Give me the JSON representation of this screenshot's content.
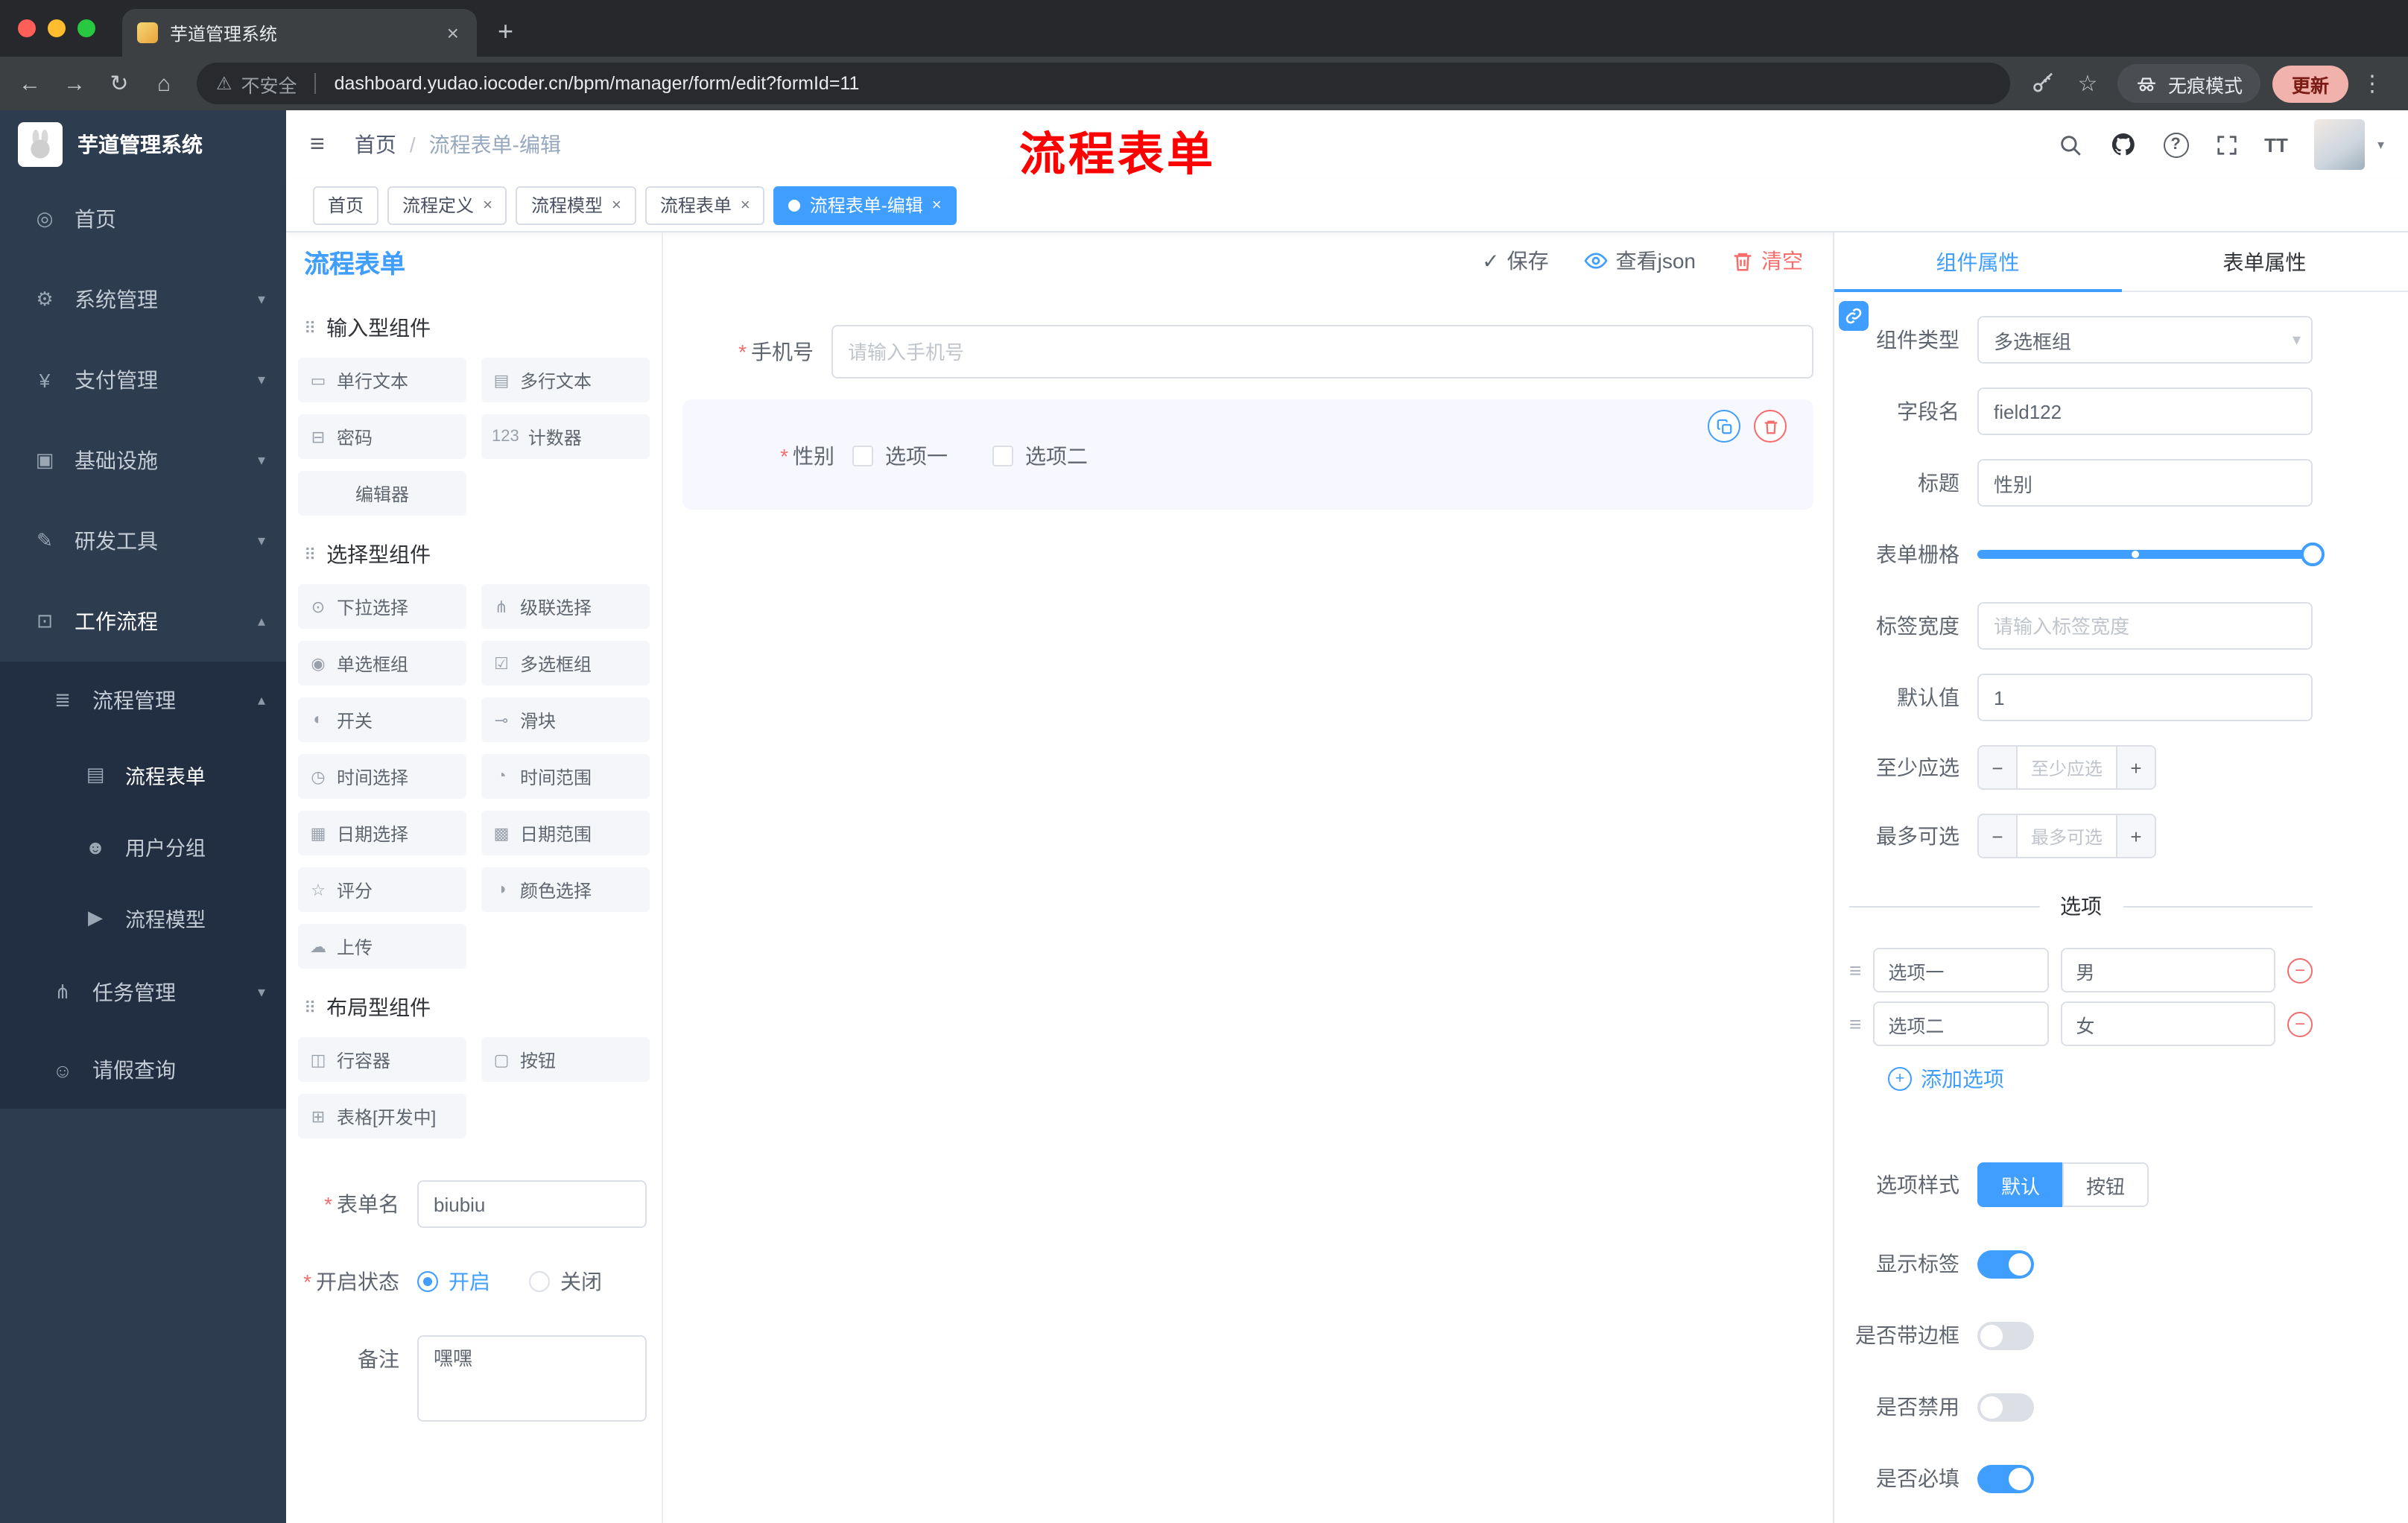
{
  "icons": {
    "back": "←",
    "forward": "→",
    "reload": "↻",
    "home": "⌂",
    "warning": "⚠",
    "star": "☆",
    "dots": "⋮",
    "close": "×",
    "new_tab": "+",
    "menu": "≡",
    "slash": "/",
    "check": "✓",
    "minus": "−",
    "plus": "+",
    "drag": "⠿",
    "handle": "≡",
    "question": "?",
    "text_size": "TT",
    "caret_down": "▾",
    "caret_up": "▴"
  },
  "browser": {
    "tab": {
      "title": "芋道管理系统"
    },
    "nav": {
      "security_label": "不安全",
      "url": "dashboard.yudao.iocoder.cn/bpm/manager/form/edit?formId=11",
      "incognito": "无痕模式",
      "update": "更新"
    }
  },
  "sidebar": {
    "title": "芋道管理系统",
    "top": [
      {
        "icon": "◎",
        "label": "首页"
      },
      {
        "icon": "⚙",
        "label": "系统管理"
      },
      {
        "icon": "¥",
        "label": "支付管理"
      },
      {
        "icon": "▣",
        "label": "基础设施"
      },
      {
        "icon": "✎",
        "label": "研发工具"
      },
      {
        "icon": "⊡",
        "label": "工作流程"
      }
    ],
    "workflow": {
      "manage": {
        "icon": "≣",
        "label": "流程管理"
      },
      "children": [
        {
          "icon": "▤",
          "label": "流程表单"
        },
        {
          "icon": "☻",
          "label": "用户分组"
        },
        {
          "icon": "▶",
          "label": "流程模型"
        }
      ],
      "task": {
        "icon": "⋔",
        "label": "任务管理"
      },
      "leave": {
        "icon": "☺",
        "label": "请假查询"
      }
    }
  },
  "header": {
    "breadcrumb": {
      "home": "首页",
      "current": "流程表单-编辑"
    },
    "annotation": "流程表单"
  },
  "tags": [
    {
      "label": "首页"
    },
    {
      "label": "流程定义"
    },
    {
      "label": "流程模型"
    },
    {
      "label": "流程表单"
    },
    {
      "label": "流程表单-编辑"
    }
  ],
  "designer": {
    "brand": "流程表单",
    "actions": {
      "save": "保存",
      "view_json": "查看json",
      "clear": "清空"
    },
    "palette": {
      "groups": [
        {
          "title": "输入型组件",
          "items": [
            {
              "icon": "▭",
              "label": "单行文本"
            },
            {
              "icon": "▤",
              "label": "多行文本"
            },
            {
              "icon": "⊟",
              "label": "密码"
            },
            {
              "icon": "123",
              "label": "计数器"
            },
            {
              "label": "编辑器"
            }
          ]
        },
        {
          "title": "选择型组件",
          "items": [
            {
              "icon": "⊙",
              "label": "下拉选择"
            },
            {
              "icon": "⋔",
              "label": "级联选择"
            },
            {
              "icon": "◉",
              "label": "单选框组"
            },
            {
              "icon": "☑",
              "label": "多选框组"
            },
            {
              "icon": "◐",
              "label": "开关"
            },
            {
              "icon": "⊸",
              "label": "滑块"
            },
            {
              "icon": "◷",
              "label": "时间选择"
            },
            {
              "icon": "◔",
              "label": "时间范围"
            },
            {
              "icon": "▦",
              "label": "日期选择"
            },
            {
              "icon": "▩",
              "label": "日期范围"
            },
            {
              "icon": "☆",
              "label": "评分"
            },
            {
              "icon": "◑",
              "label": "颜色选择"
            },
            {
              "icon": "☁",
              "label": "上传"
            }
          ]
        },
        {
          "title": "布局型组件",
          "items": [
            {
              "icon": "◫",
              "label": "行容器"
            },
            {
              "icon": "▢",
              "label": "按钮"
            },
            {
              "icon": "⊞",
              "label": "表格[开发中]"
            }
          ]
        }
      ]
    },
    "meta": {
      "name_label": "表单名",
      "name_value": "biubiu",
      "status_label": "开启状态",
      "status_on": "开启",
      "status_off": "关闭",
      "remark_label": "备注",
      "remark_value": "嘿嘿"
    },
    "canvas": {
      "phone": {
        "label": "手机号",
        "placeholder": "请输入手机号"
      },
      "gender": {
        "label": "性别",
        "option1": "选项一",
        "option2": "选项二"
      }
    }
  },
  "props": {
    "tabs": {
      "component": "组件属性",
      "form": "表单属性"
    },
    "rows": {
      "type_label": "组件类型",
      "type_value": "多选框组",
      "field_label": "字段名",
      "field_value": "field122",
      "title_label": "标题",
      "title_value": "性别",
      "grid_label": "表单栅格",
      "width_label": "标签宽度",
      "width_placeholder": "请输入标签宽度",
      "default_label": "默认值",
      "default_value": "1",
      "min_label": "至少应选",
      "min_placeholder": "至少应选",
      "max_label": "最多可选",
      "max_placeholder": "最多可选"
    },
    "options": {
      "divider": "选项",
      "rows": [
        {
          "name": "选项一",
          "value": "男"
        },
        {
          "name": "选项二",
          "value": "女"
        }
      ],
      "add": "添加选项"
    },
    "style": {
      "style_label": "选项样式",
      "style_default": "默认",
      "style_button": "按钮",
      "show_label": "显示标签",
      "show_value": true,
      "border_label": "是否带边框",
      "border_value": false,
      "disabled_label": "是否禁用",
      "disabled_value": false,
      "required_label": "是否必填",
      "required_value": true
    }
  }
}
